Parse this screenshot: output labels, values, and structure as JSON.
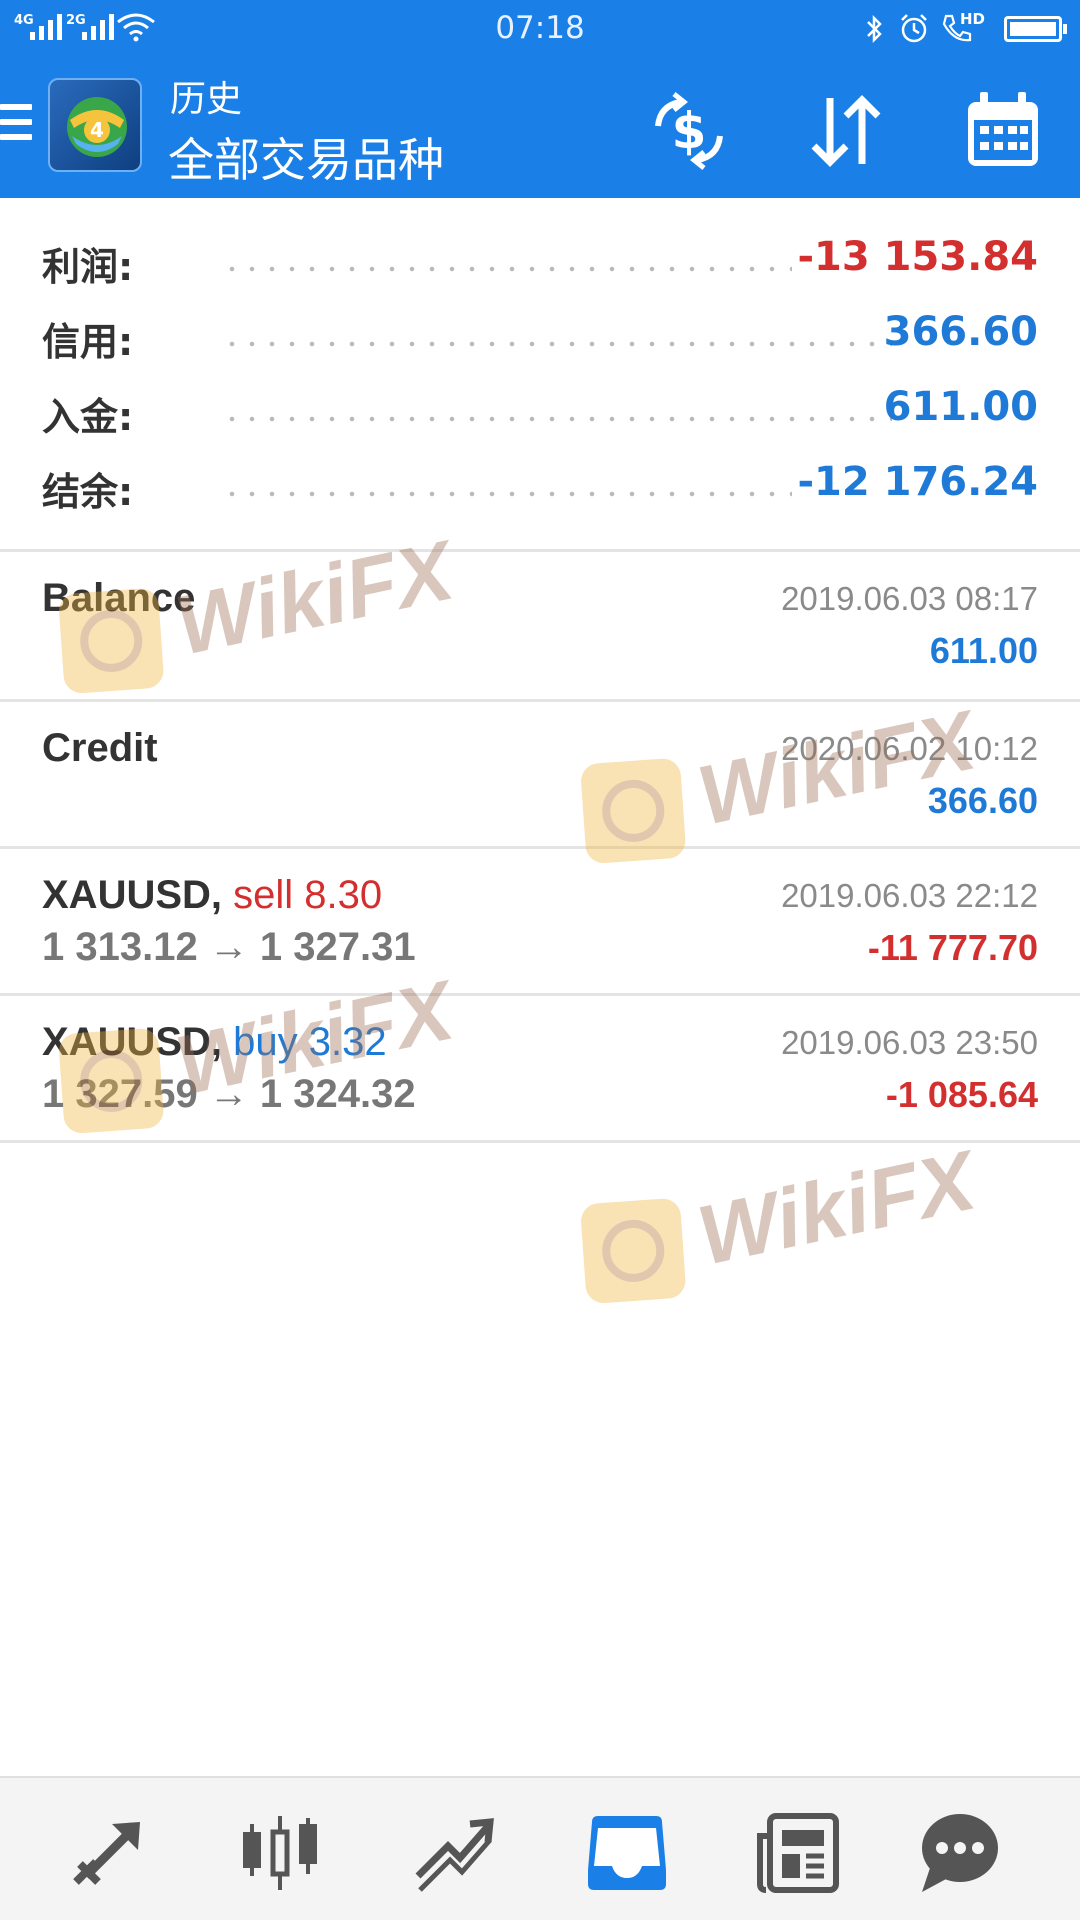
{
  "status_bar": {
    "time": "07:18",
    "network_1": "4G",
    "network_2": "2G",
    "network_3": "HD",
    "icons": [
      "signal-icon",
      "wifi-icon",
      "bluetooth-icon",
      "alarm-icon",
      "call-hd-icon",
      "battery-icon"
    ]
  },
  "app_bar": {
    "subtitle": "历史",
    "title": "全部交易品种",
    "logo_badge": "4",
    "actions": [
      "currency-exchange-icon",
      "sort-icon",
      "calendar-icon"
    ]
  },
  "summary": [
    {
      "label": "利润:",
      "value": "-13 153.84",
      "color": "red"
    },
    {
      "label": "信用:",
      "value": "366.60",
      "color": "blue"
    },
    {
      "label": "入金:",
      "value": "611.00",
      "color": "blue"
    },
    {
      "label": "结余:",
      "value": "-12 176.24",
      "color": "blue"
    }
  ],
  "deals": [
    {
      "symbol": "Balance",
      "side": "",
      "prices": "",
      "time": "2019.06.03 08:17",
      "amount": "611.00",
      "amount_color": "blue"
    },
    {
      "symbol": "Credit",
      "side": "",
      "prices": "",
      "time": "2020.06.02 10:12",
      "amount": "366.60",
      "amount_color": "blue"
    },
    {
      "symbol": "XAUUSD,",
      "side": "sell 8.30",
      "side_color": "red",
      "prices": "1 313.12 → 1 327.31",
      "time": "2019.06.03 22:12",
      "amount": "-11 777.70",
      "amount_color": "red"
    },
    {
      "symbol": "XAUUSD,",
      "side": "buy 3.32",
      "side_color": "blue",
      "prices": "1 327.59 → 1 324.32",
      "time": "2019.06.03 23:50",
      "amount": "-1 085.64",
      "amount_color": "red"
    }
  ],
  "watermark": {
    "text": "WikiFX"
  },
  "bottom_nav": [
    "trade-quotes-icon",
    "chart-candles-icon",
    "trade-icon",
    "history-inbox-icon",
    "news-icon",
    "chat-icon"
  ],
  "colors": {
    "primary": "#1a7fe6",
    "negative": "#d32f2f",
    "positive": "#1e7ad6",
    "active_nav": "#1a7fe6"
  }
}
